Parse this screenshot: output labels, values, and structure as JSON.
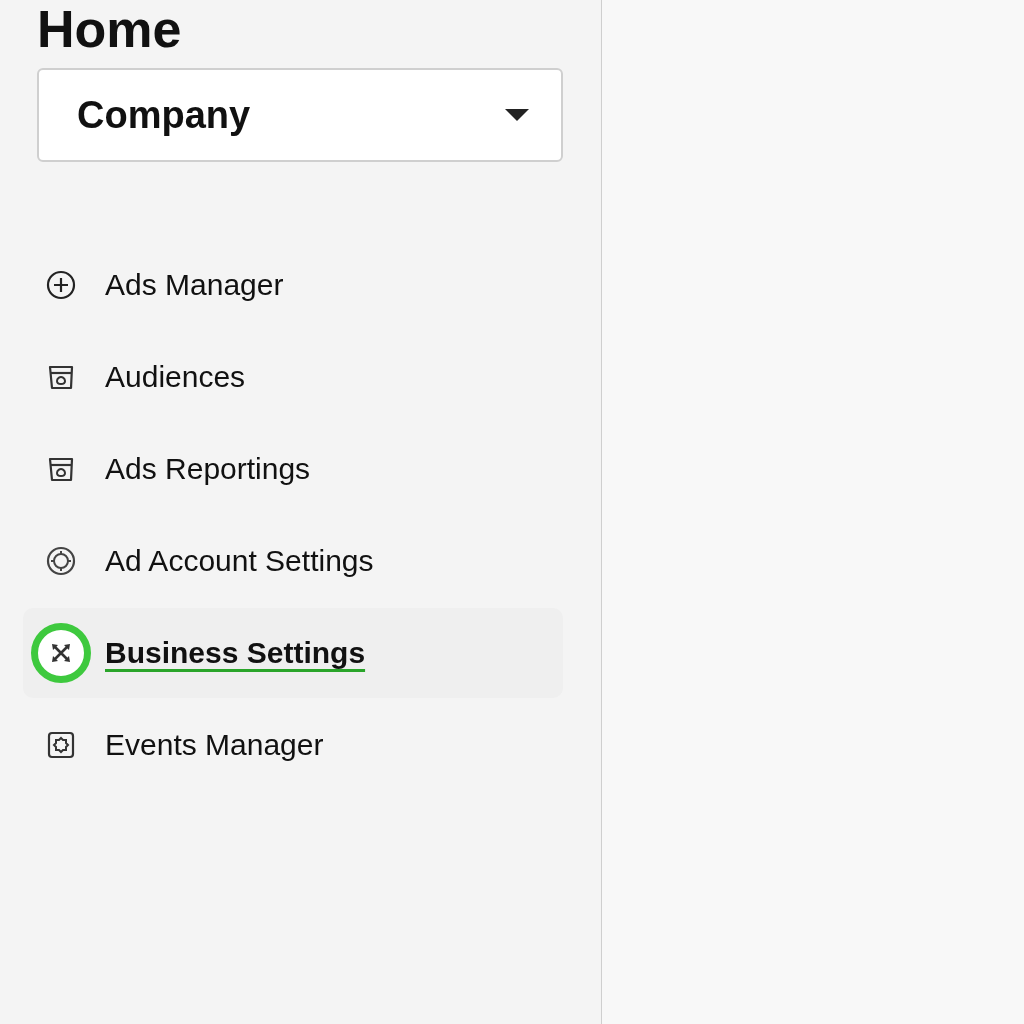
{
  "title": "Home",
  "dropdown": {
    "value": "Company"
  },
  "nav": [
    {
      "label": "Ads Manager",
      "kind": "plus",
      "selected": false
    },
    {
      "label": "Audiences",
      "kind": "box",
      "selected": false
    },
    {
      "label": "Ads Reportings",
      "kind": "box",
      "selected": false
    },
    {
      "label": "Ad Account Settings",
      "kind": "target",
      "selected": false
    },
    {
      "label": "Business Settings",
      "kind": "arrows",
      "selected": true
    },
    {
      "label": "Events Manager",
      "kind": "gear",
      "selected": false
    }
  ]
}
